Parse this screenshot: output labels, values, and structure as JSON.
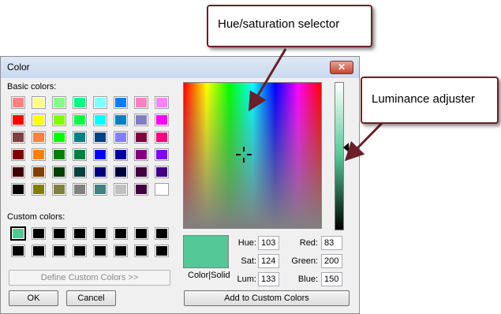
{
  "dialog": {
    "title": "Color",
    "close_glyph": "✕",
    "basic_colors_label": "Basic colors:",
    "custom_colors_label": "Custom colors:",
    "define_button": "Define Custom Colors >>",
    "ok_button": "OK",
    "cancel_button": "Cancel",
    "add_button": "Add to Custom Colors",
    "color_solid_label": "Color|Solid",
    "fields": {
      "hue_label": "Hue:",
      "hue_value": "103",
      "sat_label": "Sat:",
      "sat_value": "124",
      "lum_label": "Lum:",
      "lum_value": "133",
      "red_label": "Red:",
      "red_value": "83",
      "green_label": "Green:",
      "green_value": "200",
      "blue_label": "Blue:",
      "blue_value": "150"
    },
    "current_color": "#53c896",
    "basic_colors": [
      [
        "#ff8080",
        "#ffff80",
        "#80ff80",
        "#00ff80",
        "#80ffff",
        "#0080ff",
        "#ff80c0",
        "#ff80ff"
      ],
      [
        "#ff0000",
        "#ffff00",
        "#80ff00",
        "#00ff40",
        "#00ffff",
        "#0080c0",
        "#8080c0",
        "#ff00ff"
      ],
      [
        "#804040",
        "#ff8040",
        "#00ff00",
        "#008080",
        "#004080",
        "#8080ff",
        "#800040",
        "#ff0080"
      ],
      [
        "#800000",
        "#ff8000",
        "#008000",
        "#008040",
        "#0000ff",
        "#0000a0",
        "#800080",
        "#8000ff"
      ],
      [
        "#400000",
        "#804000",
        "#004000",
        "#004040",
        "#000080",
        "#000040",
        "#400040",
        "#400080"
      ],
      [
        "#000000",
        "#808000",
        "#808040",
        "#808080",
        "#408080",
        "#c0c0c0",
        "#400040",
        "#ffffff"
      ]
    ],
    "custom_colors": [
      [
        "#53c896",
        "#000000",
        "#000000",
        "#000000",
        "#000000",
        "#000000",
        "#000000",
        "#000000"
      ],
      [
        "#000000",
        "#000000",
        "#000000",
        "#000000",
        "#000000",
        "#000000",
        "#000000",
        "#000000"
      ]
    ]
  },
  "callouts": {
    "hue_saturation": "Hue/saturation selector",
    "luminance": "Luminance adjuster"
  },
  "colors": {
    "callout_border": "#6b1f2a",
    "arrow": "#6b1f2a"
  }
}
